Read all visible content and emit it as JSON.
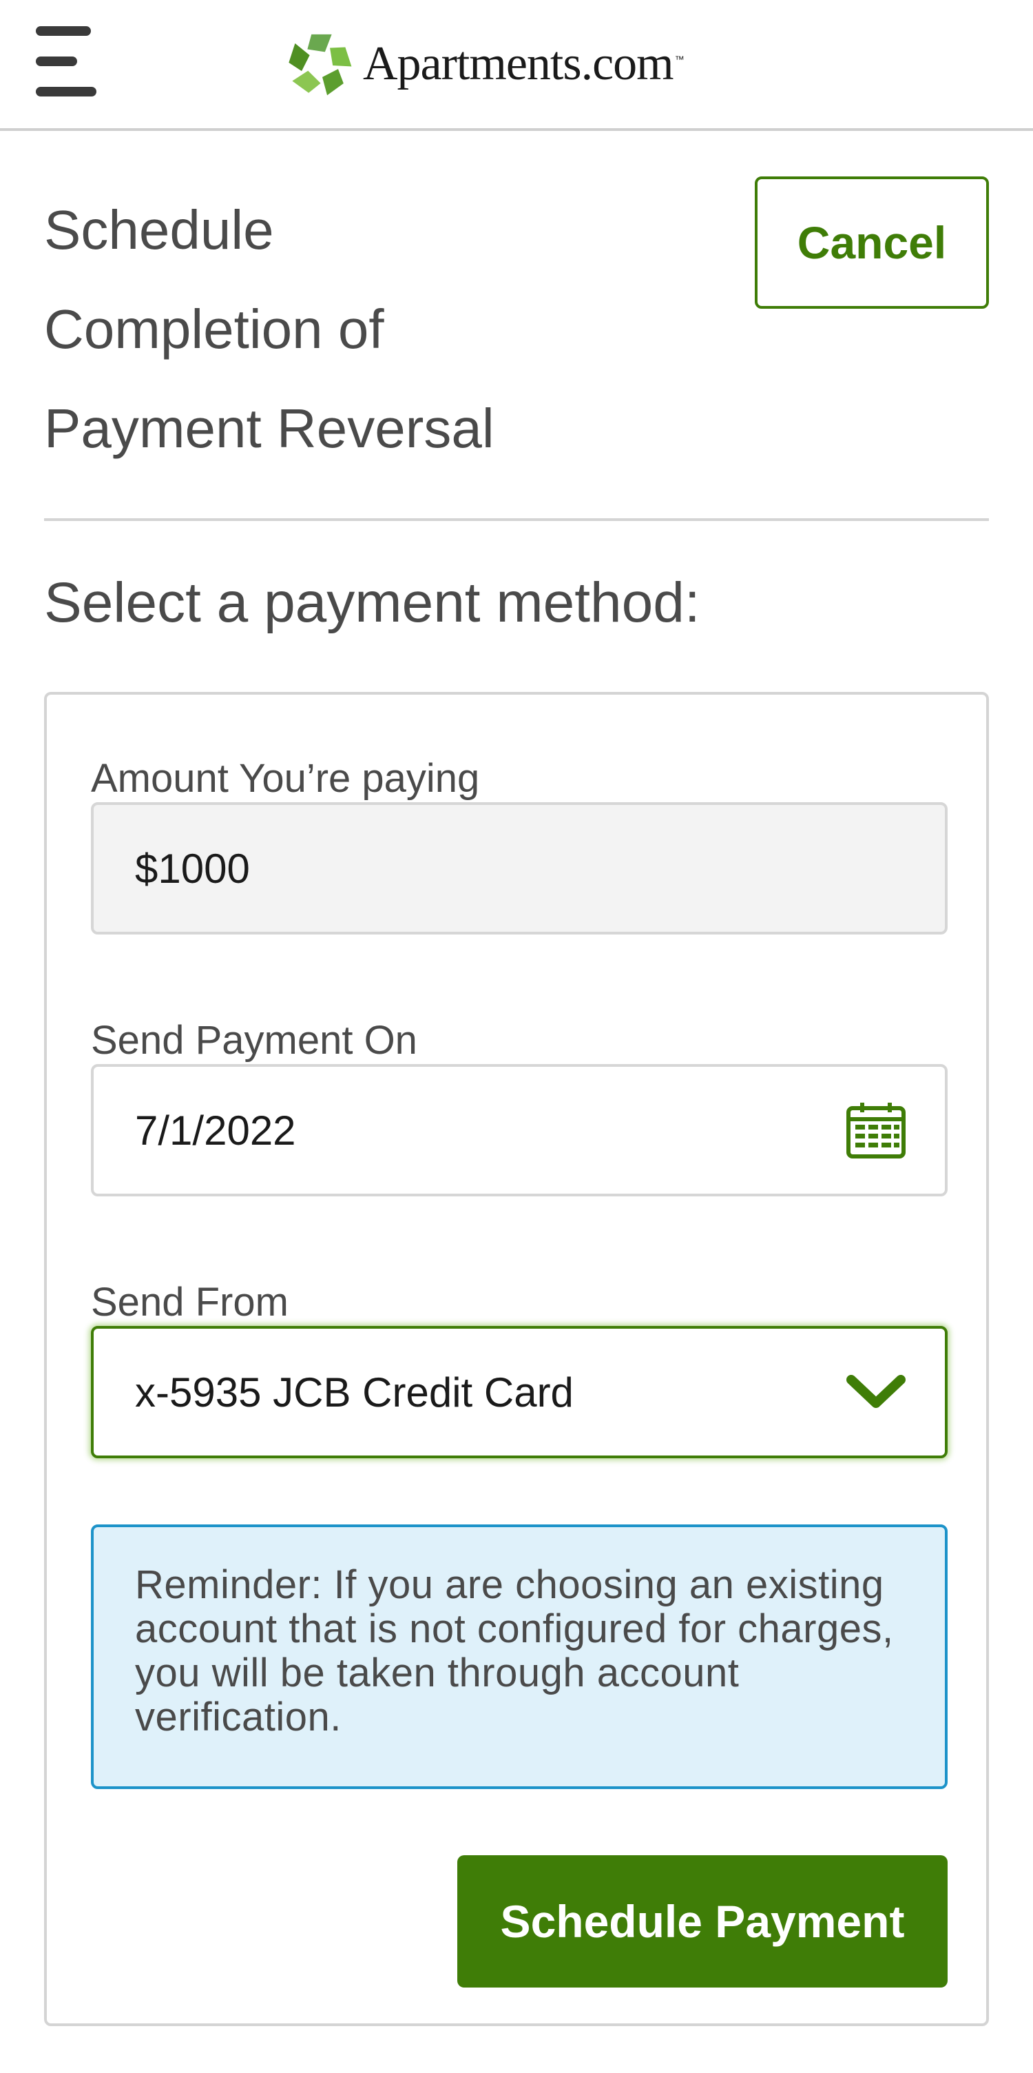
{
  "header": {
    "brand_name": "Apartments.com",
    "brand_tm": "™",
    "menu_icon": "hamburger-menu-icon",
    "logo_icon": "apartments-logo-icon"
  },
  "page": {
    "title": "Schedule\nCompletion of\nPayment Reversal",
    "cancel_label": "Cancel",
    "section_heading": "Select a payment method:"
  },
  "form": {
    "amount": {
      "label": "Amount You’re paying",
      "value": "$1000"
    },
    "send_on": {
      "label": "Send Payment On",
      "value": "7/1/2022",
      "icon": "calendar-icon"
    },
    "send_from": {
      "label": "Send From",
      "selected": "x-5935 JCB Credit Card",
      "icon": "chevron-down-icon"
    },
    "reminder": "Reminder: If you are choosing an existing account that is not configured for charges, you will be taken through account verification.",
    "submit_label": "Schedule Payment"
  },
  "colors": {
    "brand_green": "#3f7d07",
    "info_border": "#1d93c9",
    "info_background": "#dff1fa",
    "text": "#4a4a4a"
  }
}
